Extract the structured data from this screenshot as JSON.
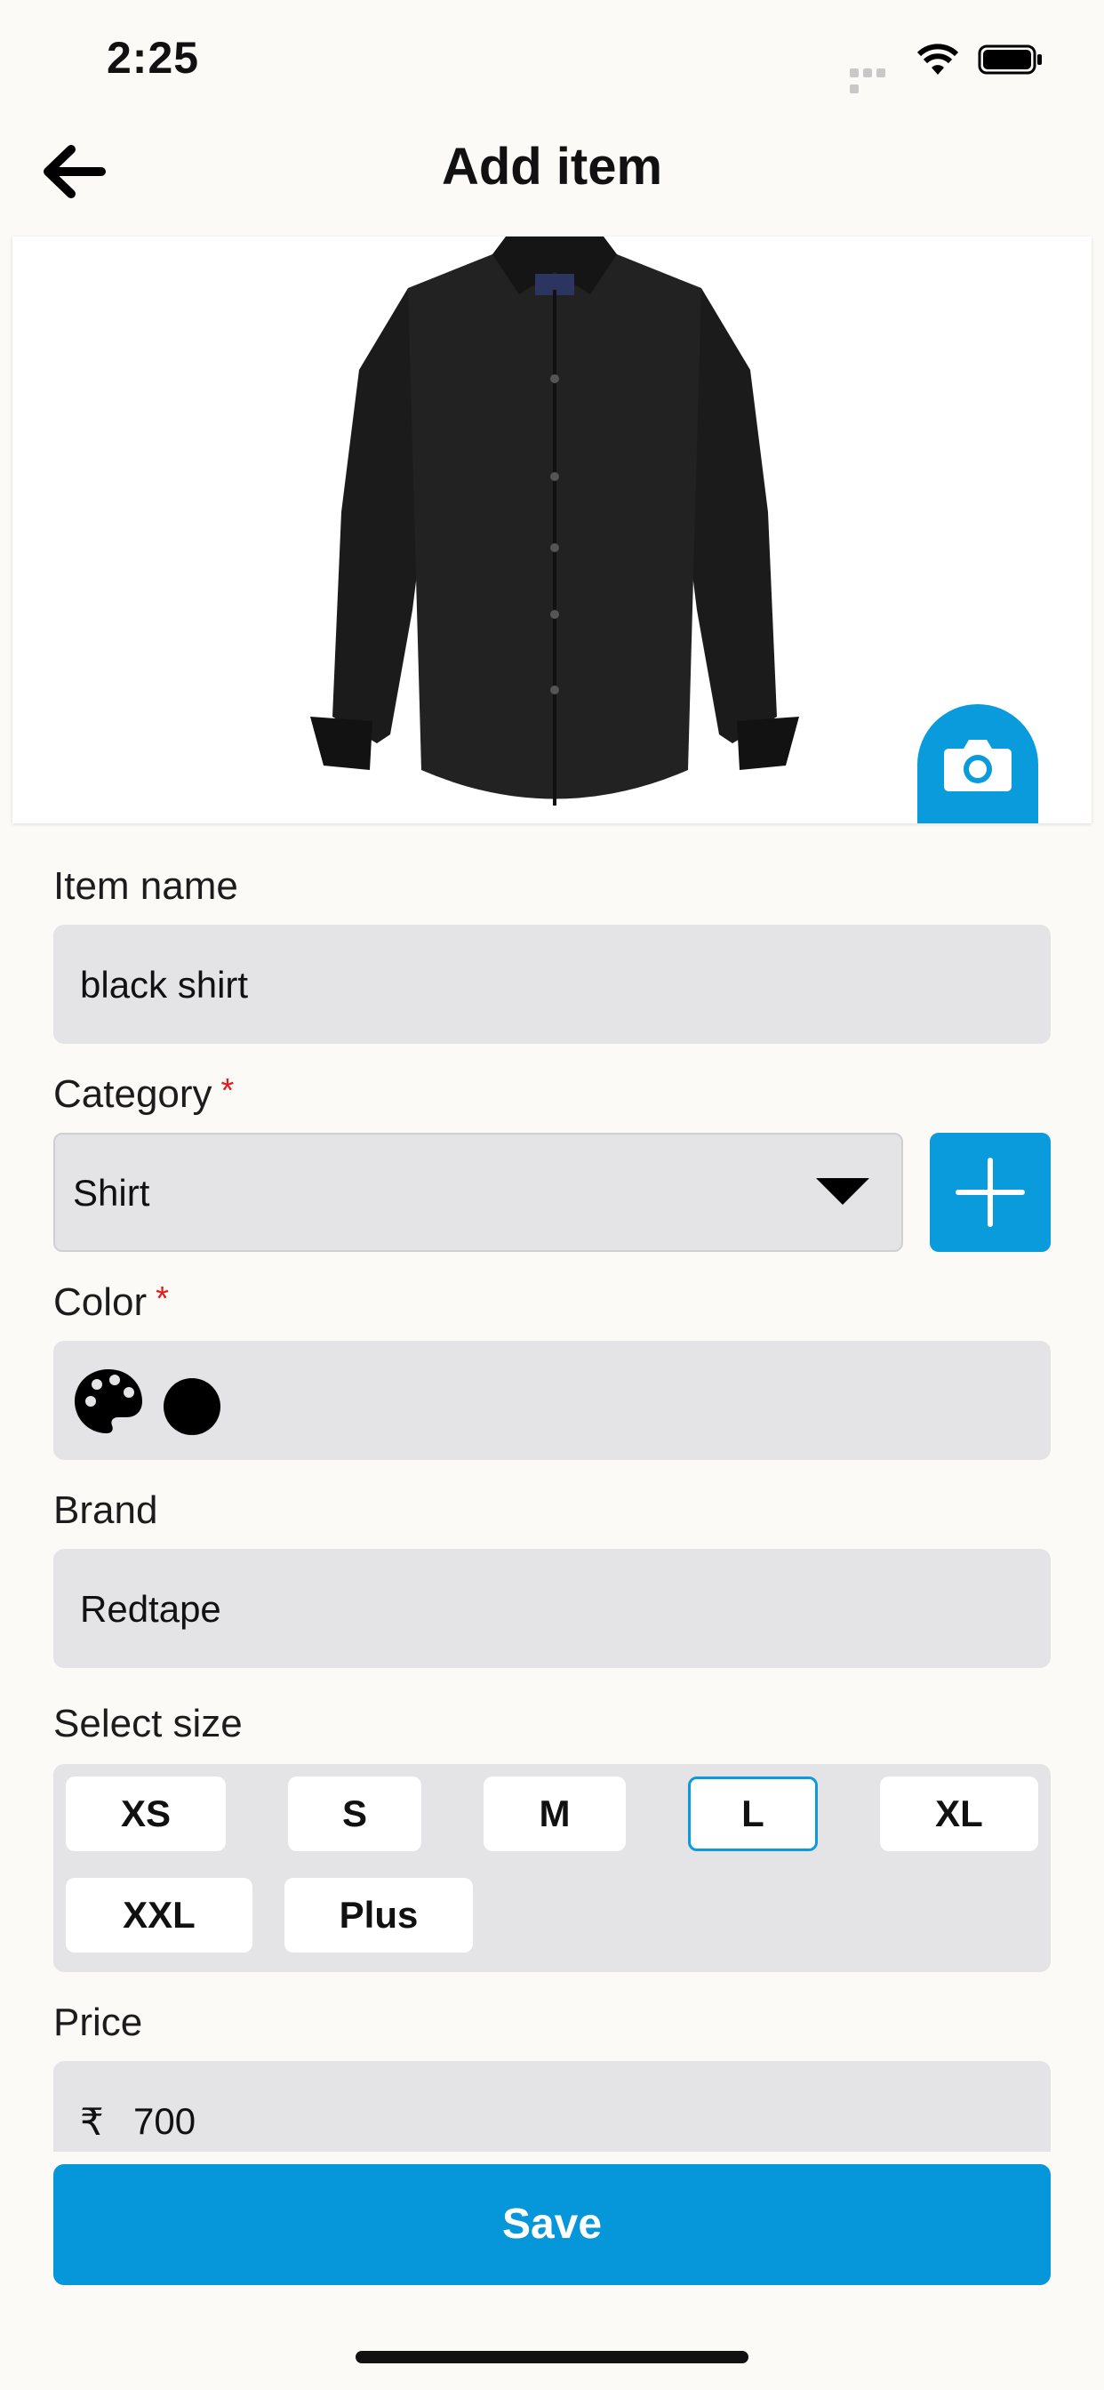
{
  "status_bar": {
    "time": "2:25"
  },
  "header": {
    "title": "Add item"
  },
  "form": {
    "item_name": {
      "label": "Item name",
      "value": "black shirt"
    },
    "category": {
      "label": "Category",
      "required_mark": "*",
      "value": "Shirt"
    },
    "color": {
      "label": "Color",
      "required_mark": "*",
      "selected_color": "#000000"
    },
    "brand": {
      "label": "Brand",
      "value": "Redtape"
    },
    "size": {
      "label": "Select size",
      "options": [
        "XS",
        "S",
        "M",
        "L",
        "XL",
        "XXL",
        "Plus"
      ],
      "selected": "L"
    },
    "price": {
      "label": "Price",
      "currency": "₹",
      "value": "700"
    }
  },
  "actions": {
    "save_label": "Save"
  },
  "colors": {
    "accent": "#0a9bdc",
    "field_bg": "#e4e4e6",
    "required": "#e21b1b"
  },
  "icons": [
    "back-arrow-icon",
    "camera-icon",
    "plus-icon",
    "chevron-down-icon",
    "palette-icon"
  ]
}
